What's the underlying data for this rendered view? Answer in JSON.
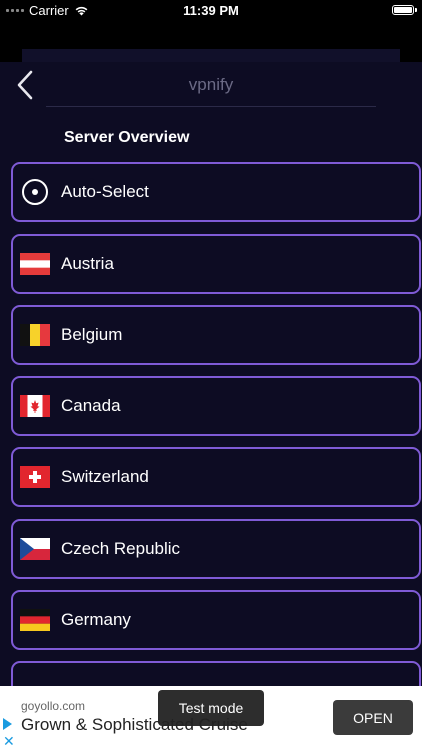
{
  "status_bar": {
    "carrier": "Carrier",
    "time": "11:39 PM"
  },
  "nav": {
    "title": "vpnify",
    "back_icon": "chevron-left-icon"
  },
  "section_title": "Server Overview",
  "servers": [
    {
      "label": "Auto-Select",
      "icon": "radio-target-icon"
    },
    {
      "label": "Austria",
      "icon": "flag-austria-icon"
    },
    {
      "label": "Belgium",
      "icon": "flag-belgium-icon"
    },
    {
      "label": "Canada",
      "icon": "flag-canada-icon"
    },
    {
      "label": "Switzerland",
      "icon": "flag-switzerland-icon"
    },
    {
      "label": "Czech Republic",
      "icon": "flag-czech-icon"
    },
    {
      "label": "Germany",
      "icon": "flag-germany-icon"
    }
  ],
  "ad": {
    "domain": "goyollo.com",
    "headline": "Grown & Sophisticated Cruise",
    "open_label": "OPEN",
    "test_mode": "Test mode"
  },
  "colors": {
    "background": "#0d0c23",
    "border_accent": "#7f5bd6"
  }
}
